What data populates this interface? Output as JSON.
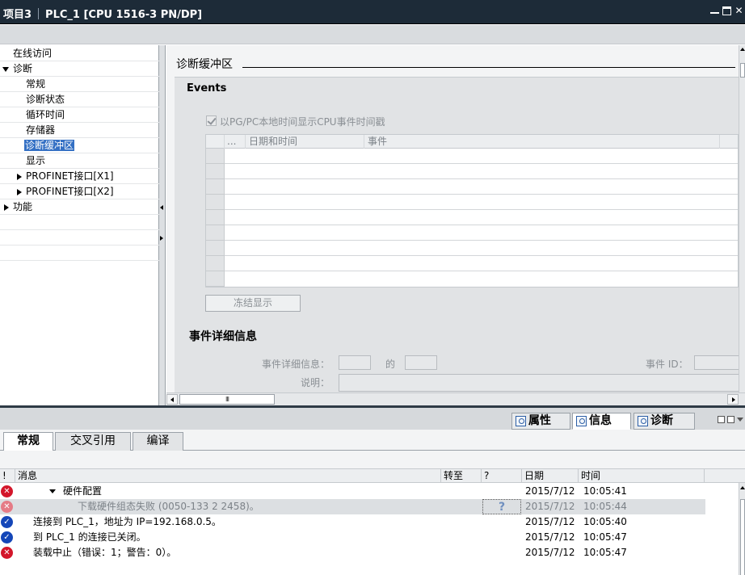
{
  "window": {
    "title_project": "项目3",
    "title_device": "PLC_1 [CPU 1516-3 PN/DP]"
  },
  "tree": {
    "items": [
      {
        "label": "在线访问"
      },
      {
        "label": "诊断"
      },
      {
        "label": "常规"
      },
      {
        "label": "诊断状态"
      },
      {
        "label": "循环时间"
      },
      {
        "label": "存储器"
      },
      {
        "label": "诊断缓冲区"
      },
      {
        "label": "显示"
      },
      {
        "label": "PROFINET接口[X1]"
      },
      {
        "label": "PROFINET接口[X2]"
      },
      {
        "label": "功能"
      }
    ]
  },
  "main": {
    "section_title": "诊断缓冲区",
    "events_title": "Events",
    "checkbox_label": "以PG/PC本地时间显示CPU事件时间戳",
    "checkbox_checked": true,
    "grid_headers": [
      "...",
      "日期和时间",
      "事件"
    ],
    "freeze_button": "冻结显示",
    "detail_title": "事件详细信息",
    "detail_label": "事件详细信息：",
    "of_label": "的",
    "event_id_label": "事件 ID：",
    "description_label": "说明："
  },
  "hscroll": {
    "thumb_label": "III"
  },
  "inspector": {
    "tabs": [
      {
        "label": "属性",
        "icon": "properties-icon"
      },
      {
        "label": "信息",
        "icon": "info-icon"
      },
      {
        "label": "诊断",
        "icon": "diagnostics-icon"
      }
    ],
    "active_tab": "信息",
    "sub_tabs": [
      "常规",
      "交叉引用",
      "编译"
    ],
    "active_sub_tab": "常规"
  },
  "messages": {
    "columns": [
      "!",
      "消息",
      "转至",
      "?",
      "日期",
      "时间"
    ],
    "rows": [
      {
        "status": "error",
        "message": "硬件配置",
        "goto": "",
        "help": "",
        "date": "2015/7/12",
        "time": "10:05:41"
      },
      {
        "status": "error",
        "message": "下载硬件组态失败 (0050-133 2 2458)。",
        "goto": "",
        "help": "?",
        "date": "2015/7/12",
        "time": "10:05:44"
      },
      {
        "status": "ok",
        "message": "连接到 PLC_1，地址为 IP=192.168.0.5。",
        "goto": "",
        "help": "",
        "date": "2015/7/12",
        "time": "10:05:40"
      },
      {
        "status": "ok",
        "message": "到 PLC_1 的连接已关闭。",
        "goto": "",
        "help": "",
        "date": "2015/7/12",
        "time": "10:05:47"
      },
      {
        "status": "error",
        "message": "装载中止（错误：1；警告：0）。",
        "goto": "",
        "help": "",
        "date": "2015/7/12",
        "time": "10:05:47"
      }
    ]
  },
  "colors": {
    "titlebar": "#1d2b38",
    "selection": "#3470c4",
    "error": "#d3162a",
    "ok": "#1446b8"
  }
}
